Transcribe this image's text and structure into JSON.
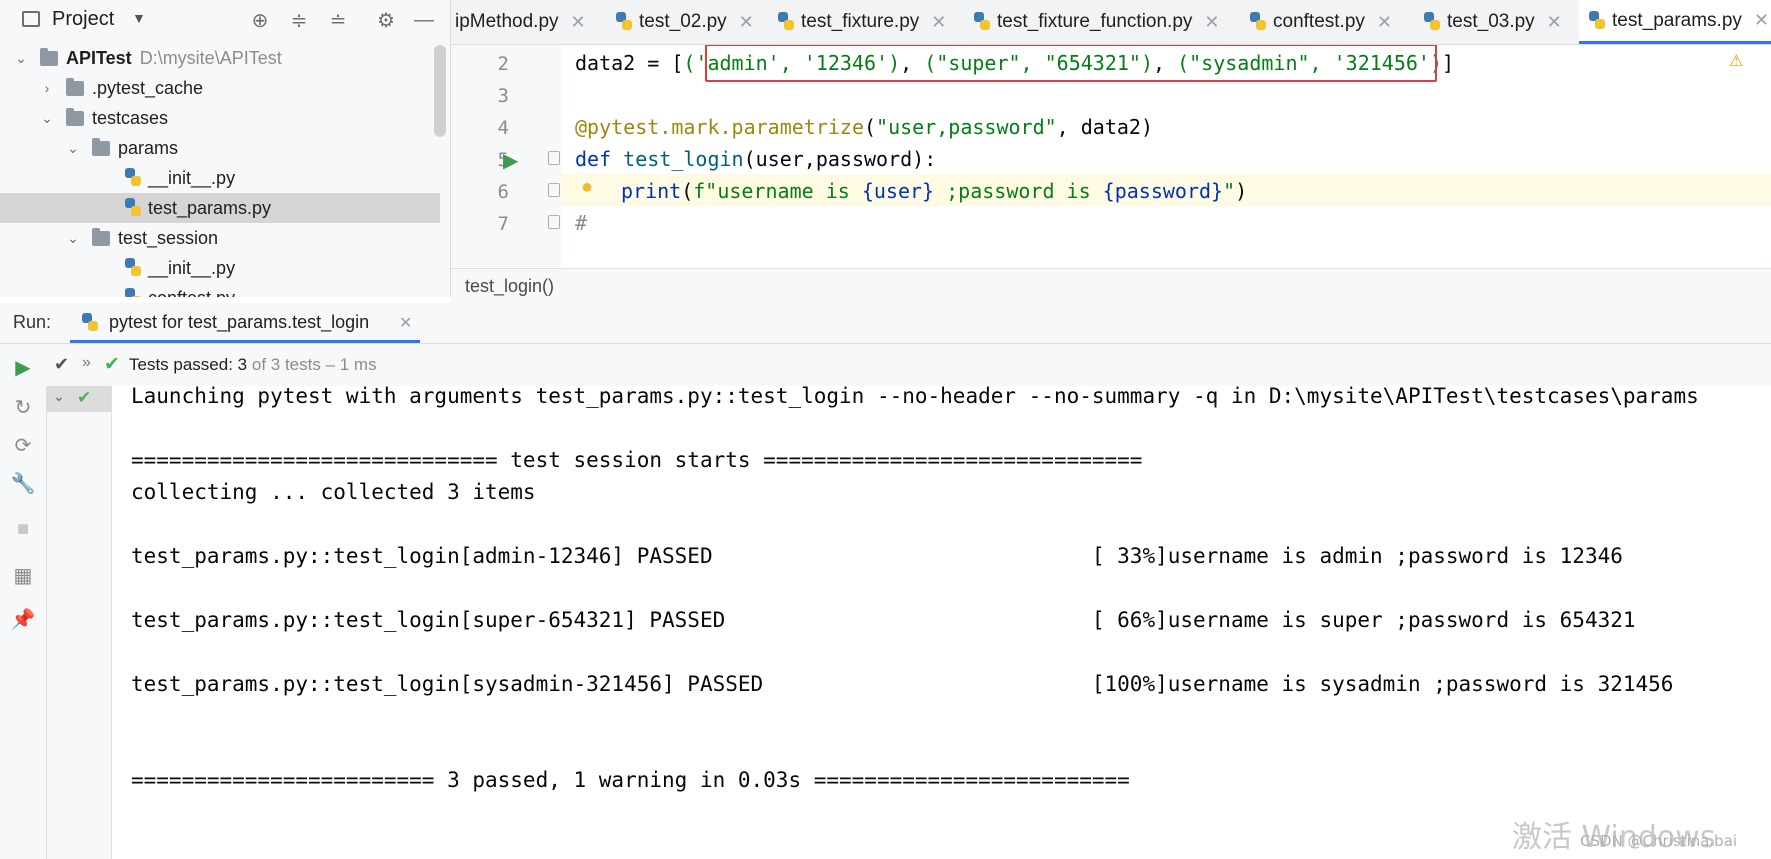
{
  "project_panel": {
    "title": "Project",
    "tree": [
      {
        "label": "APITest",
        "path": "D:\\mysite\\APITest"
      },
      {
        "label": ".pytest_cache"
      },
      {
        "label": "testcases"
      },
      {
        "label": "params"
      },
      {
        "label": "__init__.py"
      },
      {
        "label": "test_params.py"
      },
      {
        "label": "test_session"
      },
      {
        "label": "__init__.py"
      },
      {
        "label": "conftest.py"
      }
    ]
  },
  "tabs": [
    {
      "label": "ipMethod.py"
    },
    {
      "label": "test_02.py"
    },
    {
      "label": "test_fixture.py"
    },
    {
      "label": "test_fixture_function.py"
    },
    {
      "label": "conftest.py"
    },
    {
      "label": "test_03.py"
    },
    {
      "label": "test_params.py"
    }
  ],
  "editor": {
    "line_numbers": [
      "2",
      "3",
      "4",
      "5",
      "6",
      "7"
    ],
    "line2": {
      "var": "data2 = [",
      "s1": "('admin', '12346')",
      "sep1": ", ",
      "s2": "(\"super\", \"654321\")",
      "sep2": ", ",
      "s3": "(\"sysadmin\", '321456')",
      "end": "]"
    },
    "line4": {
      "decorator": "@pytest.mark.parametrize",
      "open": "(",
      "args": "\"user,password\"",
      "rest": ", data2)"
    },
    "line5": {
      "kw": "def ",
      "fn": "test_login",
      "params": "(user,password):"
    },
    "line6": {
      "fn": "print",
      "open": "(",
      "fstr_a": "f\"username is ",
      "b1": "{user}",
      "fstr_b": " ;password is ",
      "b2": "{password}",
      "fstr_c": "\"",
      "close": ")"
    },
    "line7": {
      "text": "#"
    },
    "breadcrumb": "test_login()",
    "warning_mark": "⚠"
  },
  "run": {
    "label": "Run:",
    "tab_label": "pytest for test_params.test_login",
    "status_prefix": "Tests passed: ",
    "status_count": "3",
    "status_suffix": " of 3 tests – 1 ms"
  },
  "console": {
    "lines": [
      "Launching pytest with arguments test_params.py::test_login --no-header --no-summary -q in D:\\mysite\\APITest\\testcases\\params",
      "",
      "============================= test session starts ==============================",
      "collecting ... collected 3 items",
      "",
      "test_params.py::test_login[admin-12346] PASSED                              [ 33%]username is admin ;password is 12346",
      "",
      "test_params.py::test_login[super-654321] PASSED                             [ 66%]username is super ;password is 654321",
      "",
      "test_params.py::test_login[sysadmin-321456] PASSED                          [100%]username is sysadmin ;password is 321456",
      "",
      "",
      "======================== 3 passed, 1 warning in 0.03s ========================="
    ]
  },
  "watermarks": {
    "activate": "激活 Windows",
    "csdn": "CSDN @Christina.bai"
  },
  "colors": {
    "accent": "#3574f0",
    "highlight_box": "#e03c3c",
    "pass_green": "#4caf50",
    "string_green": "#067d17",
    "keyword_blue": "#0033b3"
  }
}
